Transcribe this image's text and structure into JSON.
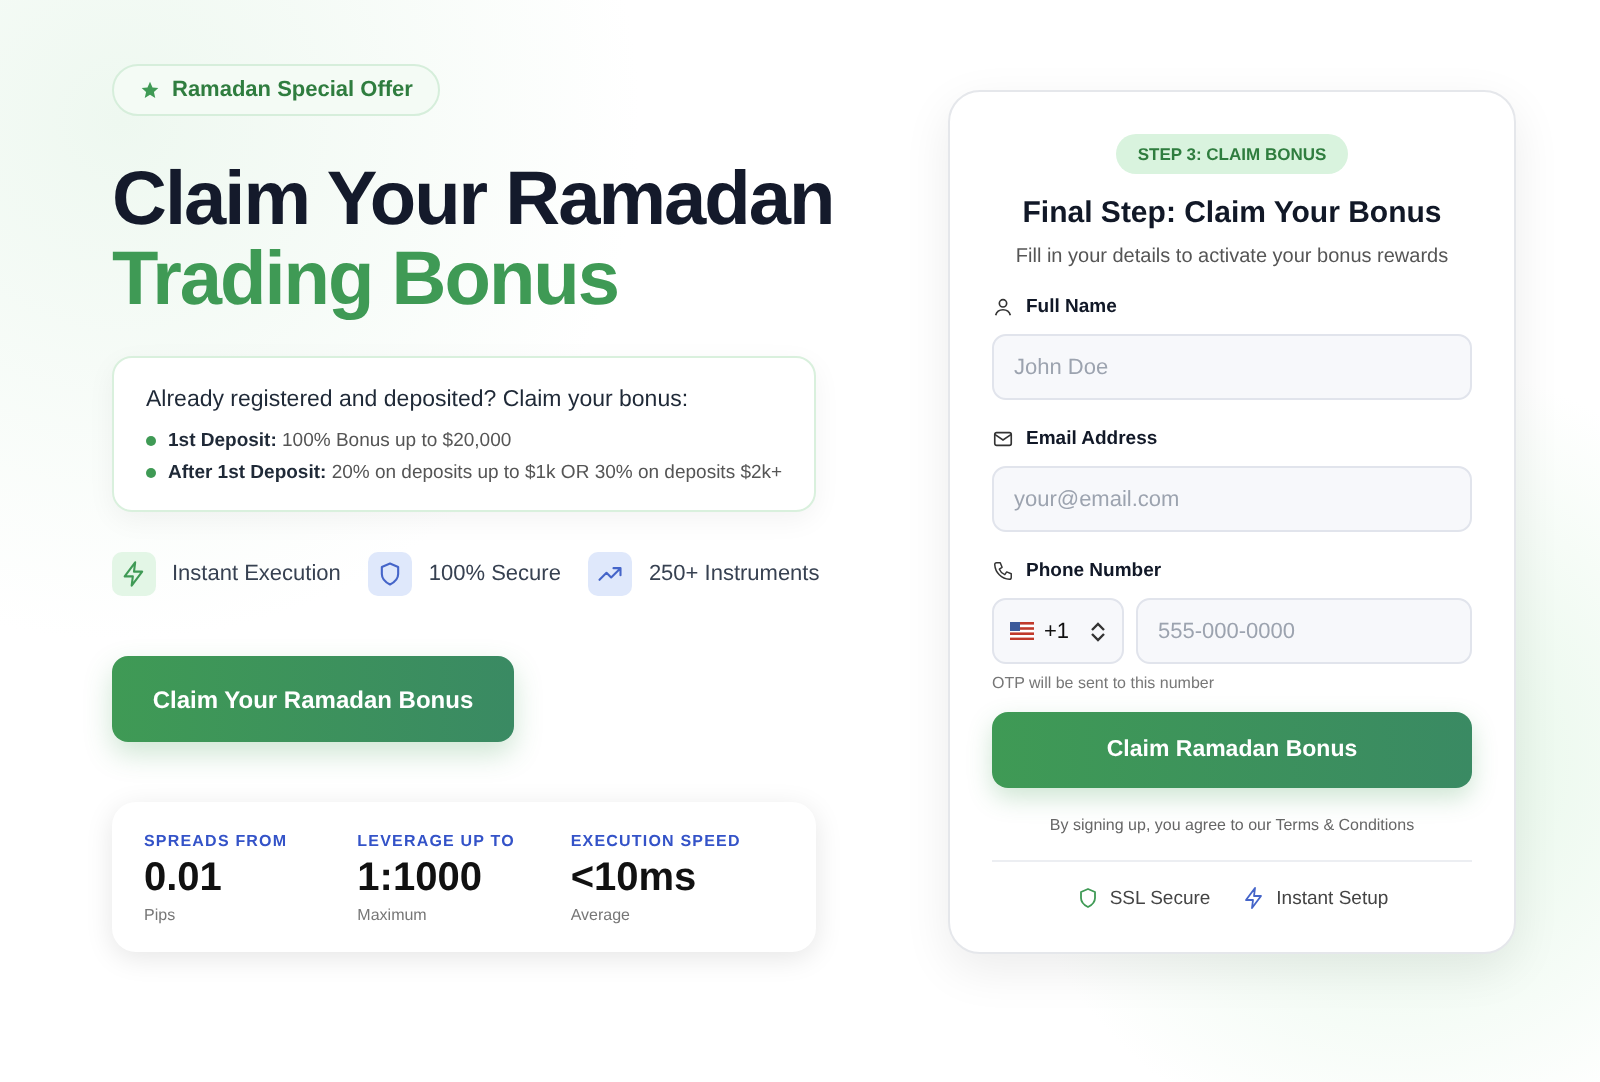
{
  "offer_badge": "Ramadan Special Offer",
  "headline": {
    "line_1": "Claim Your Ramadan",
    "line_2": "Trading Bonus"
  },
  "info_card": {
    "title": "Already registered and deposited? Claim your bonus:",
    "items": [
      {
        "text": "**1st Deposit:** 100% Bonus up to $20,000"
      },
      {
        "text": "**After 1st Deposit:** 20% on deposits up to $1k OR 30% on deposits $2k+"
      }
    ]
  },
  "features": [
    {
      "kind": "bolt",
      "label": "Instant Execution"
    },
    {
      "kind": "shield",
      "label": "100% Secure"
    },
    {
      "kind": "trend",
      "label": "250+ Instruments"
    }
  ],
  "cta_button": "Claim Your Ramadan Bonus",
  "stats": [
    {
      "label": "SPREADS FROM",
      "value": "0.01",
      "unit": "Pips"
    },
    {
      "label": "LEVERAGE UP TO",
      "value": "1:1000",
      "unit": "Maximum"
    },
    {
      "label": "EXECUTION SPEED",
      "value": "<10ms",
      "unit": "Average"
    }
  ],
  "form": {
    "step_badge": "STEP 3: CLAIM BONUS",
    "title": "Final Step: Claim Your Bonus",
    "subtitle": "Fill in your details to activate your bonus rewards",
    "fields": [
      {
        "kind": "person",
        "label": "Full Name",
        "placeholder": "John Doe"
      },
      {
        "kind": "mail",
        "label": "Email Address",
        "placeholder": "your@email.com"
      },
      {
        "kind": "phone",
        "label": "Phone Number",
        "country_code": "+1",
        "placeholder": "555-000-0000",
        "hint": "OTP will be sent to this number"
      }
    ],
    "submit_button": "Claim Ramadan Bonus",
    "terms": "By signing up, you agree to our Terms & Conditions",
    "badges": [
      {
        "kind": "shield",
        "label": "SSL Secure"
      },
      {
        "kind": "bolt",
        "label": "Instant Setup"
      }
    ]
  }
}
